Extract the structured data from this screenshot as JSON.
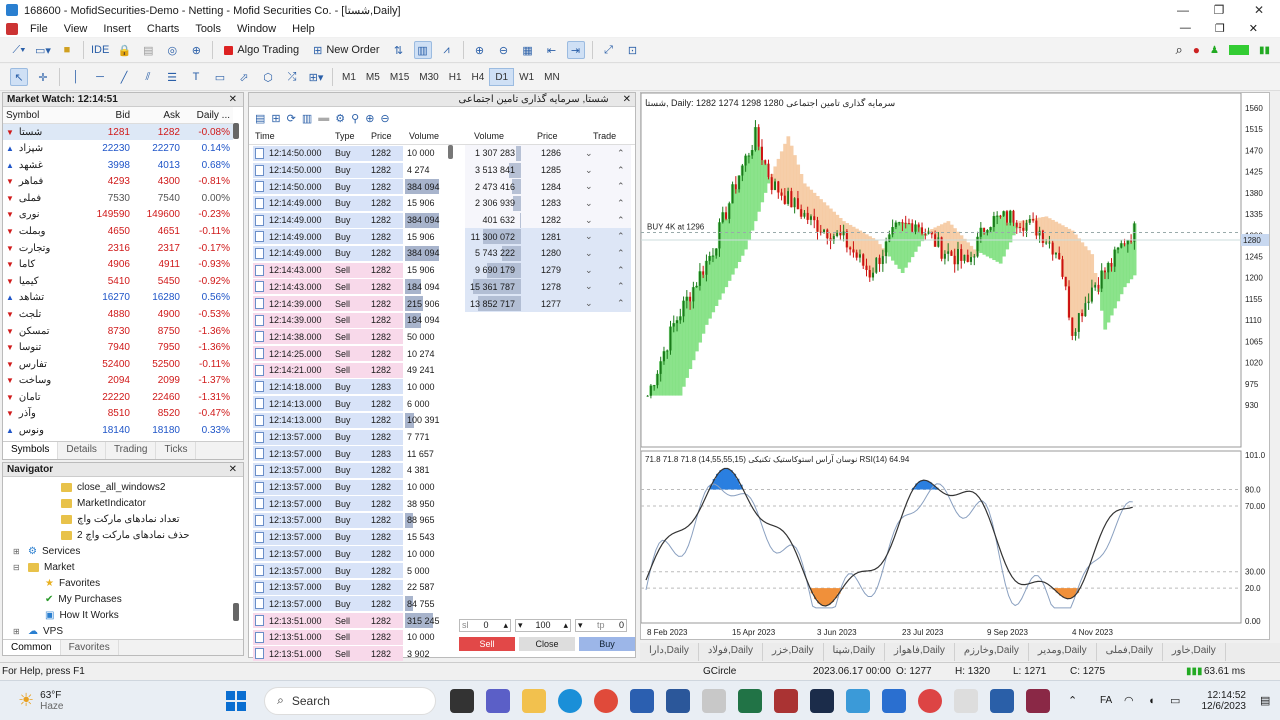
{
  "window": {
    "title": "168600 - MofidSecurities-Demo - Netting - Mofid Securities Co. - [شستا,Daily]"
  },
  "menu": [
    "File",
    "View",
    "Insert",
    "Charts",
    "Tools",
    "Window",
    "Help"
  ],
  "toolbar": {
    "algo_trading": "Algo Trading",
    "new_order": "New Order",
    "timeframes": [
      "M1",
      "M5",
      "M15",
      "M30",
      "H1",
      "H4",
      "D1",
      "W1",
      "MN"
    ],
    "active_timeframe": "D1"
  },
  "market_watch": {
    "title": "Market Watch: 12:14:51",
    "headers": [
      "Symbol",
      "Bid",
      "Ask",
      "Daily ..."
    ],
    "rows": [
      {
        "symbol": "شستا",
        "bid": "1281",
        "ask": "1282",
        "daily": "-0.08%",
        "dir": "dn"
      },
      {
        "symbol": "شپزاد",
        "bid": "22230",
        "ask": "22270",
        "daily": "0.14%",
        "dir": "up"
      },
      {
        "symbol": "غشهد",
        "bid": "3998",
        "ask": "4013",
        "daily": "0.68%",
        "dir": "up"
      },
      {
        "symbol": "فماهر",
        "bid": "4293",
        "ask": "4300",
        "daily": "-0.81%",
        "dir": "dn"
      },
      {
        "symbol": "فملی",
        "bid": "7530",
        "ask": "7540",
        "daily": "0.00%",
        "dir": "zero"
      },
      {
        "symbol": "نوری",
        "bid": "149590",
        "ask": "149600",
        "daily": "-0.23%",
        "dir": "dn"
      },
      {
        "symbol": "وبملت",
        "bid": "4650",
        "ask": "4651",
        "daily": "-0.11%",
        "dir": "dn"
      },
      {
        "symbol": "وتجارت",
        "bid": "2316",
        "ask": "2317",
        "daily": "-0.17%",
        "dir": "dn"
      },
      {
        "symbol": "کاما",
        "bid": "4906",
        "ask": "4911",
        "daily": "-0.93%",
        "dir": "dn"
      },
      {
        "symbol": "کیمیا",
        "bid": "5410",
        "ask": "5450",
        "daily": "-0.92%",
        "dir": "dn"
      },
      {
        "symbol": "تشاهد",
        "bid": "16270",
        "ask": "16280",
        "daily": "0.56%",
        "dir": "up"
      },
      {
        "symbol": "تلجث",
        "bid": "4880",
        "ask": "4900",
        "daily": "-0.53%",
        "dir": "dn"
      },
      {
        "symbol": "تمسکن",
        "bid": "8730",
        "ask": "8750",
        "daily": "-1.36%",
        "dir": "dn"
      },
      {
        "symbol": "تنوسا",
        "bid": "7940",
        "ask": "7950",
        "daily": "-1.36%",
        "dir": "dn"
      },
      {
        "symbol": "تفارس",
        "bid": "52400",
        "ask": "52500",
        "daily": "-0.11%",
        "dir": "dn"
      },
      {
        "symbol": "وساخت",
        "bid": "2094",
        "ask": "2099",
        "daily": "-1.37%",
        "dir": "dn"
      },
      {
        "symbol": "تامان",
        "bid": "22220",
        "ask": "22460",
        "daily": "-1.31%",
        "dir": "dn"
      },
      {
        "symbol": "وآذر",
        "bid": "8510",
        "ask": "8520",
        "daily": "-0.47%",
        "dir": "dn"
      },
      {
        "symbol": "ونوس",
        "bid": "18140",
        "ask": "18180",
        "daily": "0.33%",
        "dir": "up"
      }
    ],
    "tabs": [
      "Symbols",
      "Details",
      "Trading",
      "Ticks"
    ]
  },
  "navigator": {
    "title": "Navigator",
    "items": [
      {
        "label": "close_all_windows2",
        "kind": "script",
        "level": 3
      },
      {
        "label": "MarketIndicator",
        "kind": "script",
        "level": 3
      },
      {
        "label": "تعداد نمادهای مارکت واچ",
        "kind": "script",
        "level": 3
      },
      {
        "label": "حذف نمادهای مارکت واچ 2",
        "kind": "script",
        "level": 3
      },
      {
        "label": "Services",
        "kind": "gear",
        "level": 1
      },
      {
        "label": "Market",
        "kind": "folder",
        "level": 1
      },
      {
        "label": "Favorites",
        "kind": "star",
        "level": 2
      },
      {
        "label": "My Purchases",
        "kind": "check",
        "level": 2
      },
      {
        "label": "How It Works",
        "kind": "doc",
        "level": 2
      },
      {
        "label": "VPS",
        "kind": "vps",
        "level": 1
      }
    ],
    "tabs": [
      "Common",
      "Favorites"
    ]
  },
  "time_sales": {
    "title": "شستا, سرمایه گذاری تامین اجتماعی",
    "headers": [
      "Time",
      "Type",
      "Price",
      "Volume",
      "Volume",
      "Price",
      "Trade"
    ],
    "ticks": [
      [
        "12:14:50.000",
        "Buy",
        "1282",
        "10 000",
        0
      ],
      [
        "12:14:50.000",
        "Buy",
        "1282",
        "4 274",
        0
      ],
      [
        "12:14:50.000",
        "Buy",
        "1282",
        "384 094",
        0.85
      ],
      [
        "12:14:49.000",
        "Buy",
        "1282",
        "15 906",
        0
      ],
      [
        "12:14:49.000",
        "Buy",
        "1282",
        "384 094",
        0.85
      ],
      [
        "12:14:49.000",
        "Buy",
        "1282",
        "15 906",
        0
      ],
      [
        "12:14:49.000",
        "Buy",
        "1282",
        "384 094",
        0.85
      ],
      [
        "12:14:43.000",
        "Sell",
        "1282",
        "15 906",
        0
      ],
      [
        "12:14:43.000",
        "Sell",
        "1282",
        "184 094",
        0.4
      ],
      [
        "12:14:39.000",
        "Sell",
        "1282",
        "215 906",
        0.45
      ],
      [
        "12:14:39.000",
        "Sell",
        "1282",
        "184 094",
        0.4
      ],
      [
        "12:14:38.000",
        "Sell",
        "1282",
        "50 000",
        0
      ],
      [
        "12:14:25.000",
        "Sell",
        "1282",
        "10 274",
        0
      ],
      [
        "12:14:21.000",
        "Sell",
        "1282",
        "49 241",
        0
      ],
      [
        "12:14:18.000",
        "Buy",
        "1283",
        "10 000",
        0
      ],
      [
        "12:14:13.000",
        "Buy",
        "1282",
        "6 000",
        0
      ],
      [
        "12:14:13.000",
        "Buy",
        "1282",
        "100 391",
        0.22
      ],
      [
        "12:13:57.000",
        "Buy",
        "1282",
        "7 771",
        0
      ],
      [
        "12:13:57.000",
        "Buy",
        "1283",
        "11 657",
        0
      ],
      [
        "12:13:57.000",
        "Buy",
        "1282",
        "4 381",
        0
      ],
      [
        "12:13:57.000",
        "Buy",
        "1282",
        "10 000",
        0
      ],
      [
        "12:13:57.000",
        "Buy",
        "1282",
        "38 950",
        0
      ],
      [
        "12:13:57.000",
        "Buy",
        "1282",
        "88 965",
        0.2
      ],
      [
        "12:13:57.000",
        "Buy",
        "1282",
        "15 543",
        0
      ],
      [
        "12:13:57.000",
        "Buy",
        "1282",
        "10 000",
        0
      ],
      [
        "12:13:57.000",
        "Buy",
        "1282",
        "5 000",
        0
      ],
      [
        "12:13:57.000",
        "Buy",
        "1282",
        "22 587",
        0
      ],
      [
        "12:13:57.000",
        "Buy",
        "1282",
        "84 755",
        0.2
      ],
      [
        "12:13:51.000",
        "Sell",
        "1282",
        "315 245",
        0.7
      ],
      [
        "12:13:51.000",
        "Sell",
        "1282",
        "10 000",
        0
      ],
      [
        "12:13:51.000",
        "Sell",
        "1282",
        "3 902",
        0
      ]
    ],
    "depth": [
      [
        "1 307 283",
        "1286",
        0.1
      ],
      [
        "3 513 841",
        "1285",
        0.25
      ],
      [
        "2 473 416",
        "1284",
        0.18
      ],
      [
        "2 306 939",
        "1283",
        0.17
      ],
      [
        "401 632",
        "1282",
        0.03
      ],
      [
        "11 300 072",
        "1281",
        0.8
      ],
      [
        "5 743 222",
        "1280",
        0.4
      ],
      [
        "9 690 179",
        "1279",
        0.7
      ],
      [
        "15 361 787",
        "1278",
        1.0
      ],
      [
        "13 852 717",
        "1277",
        0.9
      ]
    ],
    "order": {
      "sl": "sl",
      "sl_val": "0",
      "qty": "100",
      "tp": "tp",
      "tp_val": "0",
      "sell": "Sell",
      "close": "Close",
      "buy": "Buy"
    }
  },
  "chart": {
    "header": "شستا, Daily: 1282 1274 1298 1280  سرمایه گذاری تامین اجتماعی",
    "buy_label": "BUY 4K at 1296",
    "price_axis": [
      "1560",
      "1515",
      "1470",
      "1425",
      "1380",
      "1335",
      "1290",
      "1245",
      "1200",
      "1155",
      "1110",
      "1065",
      "1020",
      "975",
      "930"
    ],
    "current_price": "1280",
    "sub_header": "71.8 71.8 71.8 (14,55,55,15) نوسان آراس استوکاستیک تکنیکی RSI(14) 64.94",
    "sub_axis": [
      "101.0",
      "80.0",
      "70.00",
      "30.00",
      "20.0",
      "0.00"
    ],
    "date_axis": [
      "8 Feb 2023",
      "15 Apr 2023",
      "3 Jun 2023",
      "23 Jul 2023",
      "9 Sep 2023",
      "4 Nov 2023"
    ],
    "colors": {
      "bull": "#1a7a1a",
      "bear": "#cc1111",
      "cloud_up": "#7ee07e",
      "cloud_dn": "#f5c9a0",
      "overbought": "#2a7fe0",
      "oversold": "#f0903a"
    }
  },
  "chart_tabs": [
    "دارا,Daily",
    "فولاد,Daily",
    "خزر,Daily",
    "شپنا,Daily",
    "فاهواز,Daily",
    "وخارزم,Daily",
    "ومدیر,Daily",
    "فملی,Daily",
    "خاور,Daily"
  ],
  "status": {
    "help": "For Help, press F1",
    "profile": "GCircle",
    "datetime": "2023.06.17 00:00",
    "open": "O: 1277",
    "high": "H: 1320",
    "low": "L: 1271",
    "close": "C: 1275",
    "ping": "63.61 ms"
  },
  "taskbar": {
    "weather_temp": "63°F",
    "weather_desc": "Haze",
    "search": "Search",
    "lang": "FA",
    "time": "12:14:52",
    "date": "12/6/2023"
  }
}
